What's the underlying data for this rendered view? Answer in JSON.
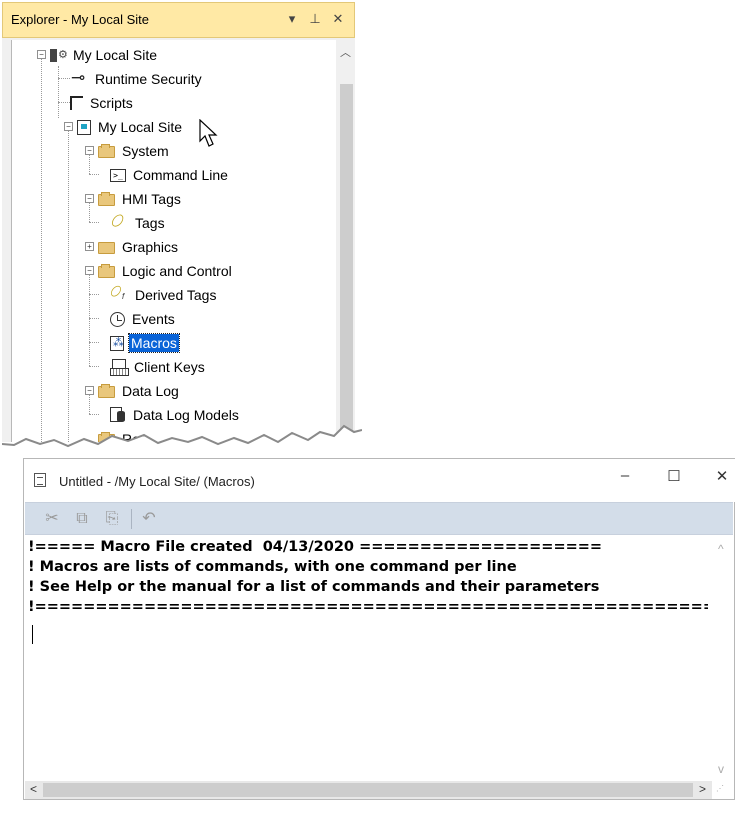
{
  "explorer": {
    "title": "Explorer - My Local Site",
    "buttons": {
      "dropdown": "▾",
      "pin": "⊥",
      "close": "✕"
    },
    "tree": [
      {
        "label": "My Local Site",
        "icon": "site-gear-icon"
      },
      {
        "label": "Runtime Security",
        "icon": "key-icon"
      },
      {
        "label": "Scripts",
        "icon": "script-icon"
      },
      {
        "label": "My Local Site",
        "icon": "site-icon"
      },
      {
        "label": "System",
        "icon": "folder-open-icon"
      },
      {
        "label": "Command Line",
        "icon": "command-line-icon"
      },
      {
        "label": "HMI Tags",
        "icon": "folder-open-icon"
      },
      {
        "label": "Tags",
        "icon": "tag-icon"
      },
      {
        "label": "Graphics",
        "icon": "folder-icon"
      },
      {
        "label": "Logic and Control",
        "icon": "folder-open-icon"
      },
      {
        "label": "Derived Tags",
        "icon": "derived-tag-icon"
      },
      {
        "label": "Events",
        "icon": "clock-icon"
      },
      {
        "label": "Macros",
        "icon": "macro-icon",
        "selected": true
      },
      {
        "label": "Client Keys",
        "icon": "keyboard-icon"
      },
      {
        "label": "Data Log",
        "icon": "folder-open-icon"
      },
      {
        "label": "Data Log Models",
        "icon": "data-log-model-icon"
      },
      {
        "label": "Re",
        "icon": "folder-open-icon"
      }
    ]
  },
  "editor": {
    "title": "Untitled - /My Local Site/ (Macros)",
    "window_buttons": {
      "minimize": "–",
      "maximize": "☐",
      "close": "✕"
    },
    "toolbar": {
      "cut": "✂",
      "copy": "⧉",
      "paste": "⎘",
      "undo": "↶"
    },
    "lines": [
      "!===== Macro File created  04/13/2020 ====================",
      "! Macros are lists of commands, with one command per line",
      "! See Help or the manual for a list of commands and their parameters",
      "!=========================================================",
      ""
    ],
    "scroll": {
      "up": "^",
      "down": "v",
      "left": "<",
      "right": ">"
    }
  },
  "colors": {
    "explorer_titlebar": "#ffe9a5",
    "selection": "#0a64d8",
    "editor_toolbar": "#d3dde9",
    "folder": "#e9c77c"
  }
}
